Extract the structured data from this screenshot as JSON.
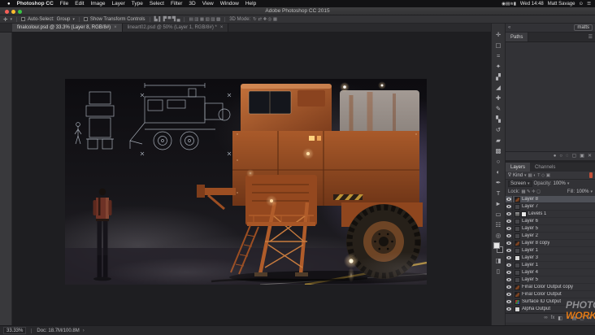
{
  "glyphs": {
    "caret": "▾",
    "chevron_left": "«",
    "close": "×",
    "menu": "☰",
    "apple": "●",
    "spotlight": "⊙",
    "notification": "☰",
    "status_chevron": "›"
  },
  "menu_bar": {
    "items": [
      "Photoshop CC",
      "File",
      "Edit",
      "Image",
      "Layer",
      "Type",
      "Select",
      "Filter",
      "3D",
      "View",
      "Window",
      "Help"
    ],
    "status_icons": [
      {
        "name": "camera-icon",
        "glyph": "◉"
      },
      {
        "name": "display-icon",
        "glyph": "▤"
      },
      {
        "name": "wifi-icon",
        "glyph": "≋"
      },
      {
        "name": "battery-icon",
        "glyph": "▮"
      }
    ],
    "clock": "Wed 14:48",
    "user": "Matt Savage"
  },
  "window": {
    "title": "Adobe Photoshop CC 2015"
  },
  "options_bar": {
    "tool_glyph": "✛",
    "auto_select_label": "Auto-Select:",
    "auto_select_value": "Group",
    "transform_label": "Show Transform Controls",
    "align_icons": [
      "▙",
      "▌",
      "▛",
      "▀",
      "▜",
      "▄"
    ],
    "distribute_icons": [
      "▤",
      "▥",
      "▦",
      "▧",
      "▨",
      "▩"
    ],
    "mode_label": "3D Mode:",
    "mode_icons": [
      "↻",
      "⇄",
      "✚",
      "◎",
      "▦"
    ]
  },
  "tab_bar": {
    "tabs": [
      {
        "label": "finalcolour.psd @ 33.3% (Layer 8, RGB/8#)",
        "active": true
      },
      {
        "label": "lineart02.psd @ 50% (Layer 1, RGB/8#) *",
        "active": false
      }
    ]
  },
  "workspace": {
    "name": "matts"
  },
  "tools": [
    {
      "name": "move-tool",
      "glyph": "✛"
    },
    {
      "name": "marquee-tool",
      "glyph": "▢"
    },
    {
      "name": "lasso-tool",
      "glyph": "≈"
    },
    {
      "name": "magic-wand-tool",
      "glyph": "✦"
    },
    {
      "name": "crop-tool",
      "glyph": "▞"
    },
    {
      "name": "eyedropper-tool",
      "glyph": "◢"
    },
    {
      "name": "healing-brush-tool",
      "glyph": "✚"
    },
    {
      "name": "brush-tool",
      "glyph": "✎"
    },
    {
      "name": "clone-stamp-tool",
      "glyph": "▚"
    },
    {
      "name": "history-brush-tool",
      "glyph": "↺"
    },
    {
      "name": "eraser-tool",
      "glyph": "▰"
    },
    {
      "name": "gradient-tool",
      "glyph": "▩"
    },
    {
      "name": "blur-tool",
      "glyph": "○"
    },
    {
      "name": "dodge-tool",
      "glyph": "◐"
    },
    {
      "name": "pen-tool",
      "glyph": "✒"
    },
    {
      "name": "type-tool",
      "glyph": "T"
    },
    {
      "name": "path-selection-tool",
      "glyph": "►"
    },
    {
      "name": "shape-tool",
      "glyph": "▭"
    },
    {
      "name": "hand-tool",
      "glyph": "☷"
    },
    {
      "name": "zoom-tool",
      "glyph": "◎"
    }
  ],
  "tool_extras": [
    {
      "name": "quick-mask-icon",
      "glyph": "◨"
    },
    {
      "name": "screen-mode-icon",
      "glyph": "▯"
    }
  ],
  "paths_panel": {
    "tab": "Paths",
    "footer_icons": [
      {
        "name": "fill-path-icon",
        "glyph": "●"
      },
      {
        "name": "stroke-path-icon",
        "glyph": "○"
      },
      {
        "name": "load-path-selection-icon",
        "glyph": "◌"
      },
      {
        "name": "path-mask-icon",
        "glyph": "▢"
      },
      {
        "name": "new-path-icon",
        "glyph": "▣"
      },
      {
        "name": "delete-path-icon",
        "glyph": "✕"
      }
    ]
  },
  "layers_panel": {
    "tabs": [
      "Layers",
      "Channels"
    ],
    "filter_funnel_glyph": "∇",
    "filter_label": "Kind",
    "filter_icons": [
      "▦",
      "◐",
      "T",
      "◇",
      "▣"
    ],
    "blend_mode": "Screen",
    "opacity_label": "Opacity:",
    "opacity_value": "100%",
    "lock_label": "Lock:",
    "lock_icons": [
      "▦",
      "✎",
      "✛",
      "◻"
    ],
    "fill_label": "Fill:",
    "fill_value": "100%",
    "layers": [
      {
        "name": "Layer 8",
        "thumb": "art",
        "selected": true
      },
      {
        "name": "Layer 7",
        "thumb": "dark"
      },
      {
        "name": "Levels 1",
        "thumb": "levels",
        "mask": true
      },
      {
        "name": "Layer 6",
        "thumb": "dark"
      },
      {
        "name": "Layer 5",
        "thumb": "dark"
      },
      {
        "name": "Layer 2",
        "thumb": "dark"
      },
      {
        "name": "Layer 8 copy",
        "thumb": "art"
      },
      {
        "name": "Layer 1",
        "thumb": "dark"
      },
      {
        "name": "Layer 3",
        "thumb": "light"
      },
      {
        "name": "Layer 1",
        "thumb": "dark"
      },
      {
        "name": "Layer 4",
        "thumb": "dark"
      },
      {
        "name": "Layer 5",
        "thumb": "dark"
      },
      {
        "name": "Final Color Output copy",
        "thumb": "art"
      },
      {
        "name": "Final Color Output",
        "thumb": "art"
      },
      {
        "name": "Surface ID Output",
        "thumb": "multi"
      },
      {
        "name": "Alpha Output",
        "thumb": "light"
      }
    ],
    "footer_icons": [
      {
        "name": "link-layers-icon",
        "glyph": "∞"
      },
      {
        "name": "layer-effects-icon",
        "glyph": "fx"
      },
      {
        "name": "layer-mask-icon",
        "glyph": "◧"
      },
      {
        "name": "adjustment-layer-icon",
        "glyph": "◑"
      },
      {
        "name": "layer-group-icon",
        "glyph": "▤"
      },
      {
        "name": "new-layer-icon",
        "glyph": "▢"
      },
      {
        "name": "delete-layer-icon",
        "glyph": "✕"
      }
    ]
  },
  "status_bar": {
    "zoom": "33.33%",
    "doc": "Doc: 18.7M/100.8M"
  },
  "watermark": {
    "line1": "PHOTOSHOP",
    "line2": "WORKBENCH",
    "accent": "#f07f13"
  }
}
